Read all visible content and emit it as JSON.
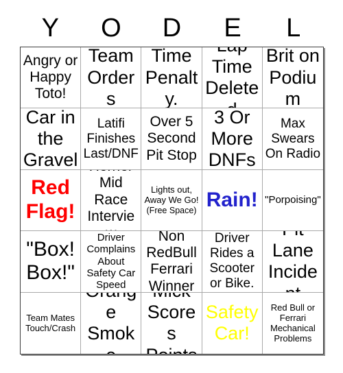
{
  "card": {
    "header_letters": [
      "Y",
      "O",
      "D",
      "E",
      "L"
    ],
    "colors": {
      "red_flag": "#ff0000",
      "rain": "#2222cc",
      "safety_car": "#ffff00",
      "text": "#000000",
      "grid_border": "#3a3a3a",
      "cell_border": "#a8a8a8",
      "background": "#ffffff"
    },
    "rows": [
      [
        {
          "text": "Angry or Happy Toto!"
        },
        {
          "text": "Team Orders"
        },
        {
          "text": "Time Penalty."
        },
        {
          "text": "Lap Time Deleted"
        },
        {
          "text": "Brit on Podium"
        }
      ],
      [
        {
          "text": "Car in the Gravel"
        },
        {
          "text": "Latifi Finishes Last/DNF"
        },
        {
          "text": "Over 5 Second Pit Stop"
        },
        {
          "text": "3 Or More DNFs"
        },
        {
          "text": "Max Swears On Radio"
        }
      ],
      [
        {
          "text": "Red Flag!"
        },
        {
          "text": "Horner Mid Race Interview"
        },
        {
          "text": "Lights out, Away We Go!",
          "subtext": "(Free Space)"
        },
        {
          "text": "Rain!"
        },
        {
          "text": "\"Porpoising\""
        }
      ],
      [
        {
          "text": "\"Box! Box!\""
        },
        {
          "text": "Driver Complains About Safety Car Speed"
        },
        {
          "text": "Non RedBull Ferrari Winner"
        },
        {
          "text": "Driver Rides a Scooter or Bike."
        },
        {
          "text": "Pit Lane Incident"
        }
      ],
      [
        {
          "text": "Team Mates Touch/Crash"
        },
        {
          "text": "Orange Smoke"
        },
        {
          "text": "Mick Scores Points"
        },
        {
          "text": "Safety Car!"
        },
        {
          "text": "Red Bull or Ferrari Mechanical Problems"
        }
      ]
    ]
  }
}
